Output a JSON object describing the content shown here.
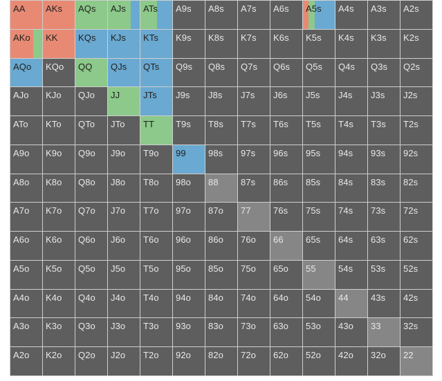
{
  "colors": {
    "raise": "#e88a73",
    "call": "#8cc98a",
    "threebet": "#6aa9d1",
    "fold": "#5e5e5e",
    "pair_fold": "#868686"
  },
  "grid": {
    "rows": [
      [
        "AA",
        "AKs",
        "AQs",
        "AJs",
        "ATs",
        "A9s",
        "A8s",
        "A7s",
        "A6s",
        "A5s",
        "A4s",
        "A3s",
        "A2s"
      ],
      [
        "AKo",
        "KK",
        "KQs",
        "KJs",
        "KTs",
        "K9s",
        "K8s",
        "K7s",
        "K6s",
        "K5s",
        "K4s",
        "K3s",
        "K2s"
      ],
      [
        "AQo",
        "KQo",
        "QQ",
        "QJs",
        "QTs",
        "Q9s",
        "Q8s",
        "Q7s",
        "Q6s",
        "Q5s",
        "Q4s",
        "Q3s",
        "Q2s"
      ],
      [
        "AJo",
        "KJo",
        "QJo",
        "JJ",
        "JTs",
        "J9s",
        "J8s",
        "J7s",
        "J6s",
        "J5s",
        "J4s",
        "J3s",
        "J2s"
      ],
      [
        "ATo",
        "KTo",
        "QTo",
        "JTo",
        "TT",
        "T9s",
        "T8s",
        "T7s",
        "T6s",
        "T5s",
        "T4s",
        "T3s",
        "T2s"
      ],
      [
        "A9o",
        "K9o",
        "Q9o",
        "J9o",
        "T9o",
        "99",
        "98s",
        "97s",
        "96s",
        "95s",
        "94s",
        "93s",
        "92s"
      ],
      [
        "A8o",
        "K8o",
        "Q8o",
        "J8o",
        "T8o",
        "98o",
        "88",
        "87s",
        "86s",
        "85s",
        "84s",
        "83s",
        "82s"
      ],
      [
        "A7o",
        "K7o",
        "Q7o",
        "J7o",
        "T7o",
        "97o",
        "87o",
        "77",
        "76s",
        "75s",
        "74s",
        "73s",
        "72s"
      ],
      [
        "A6o",
        "K6o",
        "Q6o",
        "J6o",
        "T6o",
        "96o",
        "86o",
        "76o",
        "66",
        "65s",
        "64s",
        "63s",
        "62s"
      ],
      [
        "A5o",
        "K5o",
        "Q5o",
        "J5o",
        "T5o",
        "95o",
        "85o",
        "75o",
        "65o",
        "55",
        "54s",
        "53s",
        "52s"
      ],
      [
        "A4o",
        "K4o",
        "Q4o",
        "J4o",
        "T4o",
        "94o",
        "84o",
        "74o",
        "64o",
        "54o",
        "44",
        "43s",
        "42s"
      ],
      [
        "A3o",
        "K3o",
        "Q3o",
        "J3o",
        "T3o",
        "93o",
        "83o",
        "73o",
        "63o",
        "53o",
        "43o",
        "33",
        "32s"
      ],
      [
        "A2o",
        "K2o",
        "Q2o",
        "J2o",
        "T2o",
        "92o",
        "82o",
        "72o",
        "62o",
        "52o",
        "42o",
        "32o",
        "22"
      ]
    ]
  },
  "frequencies": {
    "AA": {
      "raise": 1.0
    },
    "AKs": {
      "raise": 1.0
    },
    "AQs": {
      "call": 1.0
    },
    "AJs": {
      "call": 0.72,
      "threebet": 0.28
    },
    "ATs": {
      "call": 0.52,
      "threebet": 0.48
    },
    "A5s": {
      "raise": 0.18,
      "call": 0.18,
      "threebet": 0.64
    },
    "AKo": {
      "raise": 0.72,
      "call": 0.28
    },
    "KK": {
      "raise": 1.0
    },
    "KQs": {
      "threebet": 1.0
    },
    "KJs": {
      "threebet": 1.0
    },
    "KTs": {
      "threebet": 1.0
    },
    "AQo": {
      "threebet": 1.0
    },
    "QQ": {
      "call": 1.0
    },
    "QJs": {
      "threebet": 1.0
    },
    "QTs": {
      "threebet": 1.0
    },
    "JJ": {
      "call": 1.0
    },
    "JTs": {
      "threebet": 1.0
    },
    "TT": {
      "call": 1.0
    },
    "99": {
      "threebet": 1.0
    }
  }
}
